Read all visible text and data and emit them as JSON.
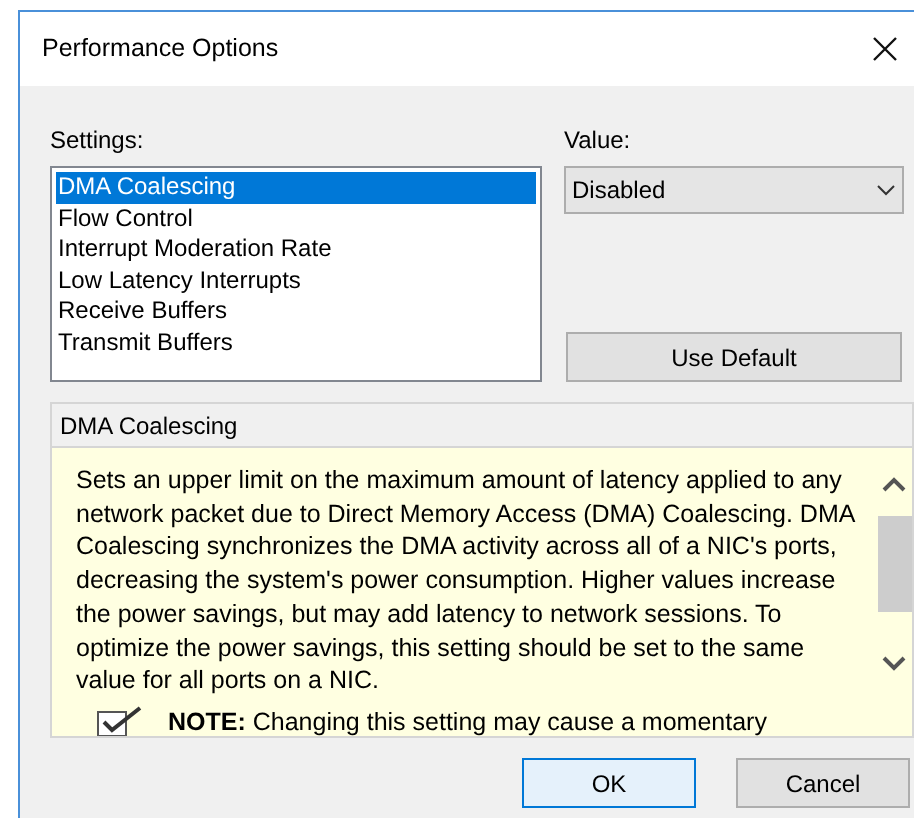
{
  "window": {
    "title": "Performance Options"
  },
  "settings": {
    "label": "Settings:",
    "items": [
      {
        "label": "DMA Coalescing",
        "selected": true
      },
      {
        "label": "Flow Control",
        "selected": false
      },
      {
        "label": "Interrupt Moderation Rate",
        "selected": false
      },
      {
        "label": "Low Latency Interrupts",
        "selected": false
      },
      {
        "label": "Receive Buffers",
        "selected": false
      },
      {
        "label": "Transmit Buffers",
        "selected": false
      }
    ]
  },
  "value": {
    "label": "Value:",
    "selected": "Disabled"
  },
  "use_default_button": "Use Default",
  "description": {
    "title": "DMA Coalescing",
    "text": "Sets an upper limit on the maximum amount of latency applied to any network packet due to Direct Memory Access (DMA) Coalescing. DMA Coalescing synchronizes the DMA activity across all of a NIC's ports, decreasing the system's power consumption. Higher values increase the power savings, but may add latency to network sessions. To optimize the power savings, this setting should be set to the same value for all ports on a NIC.",
    "note": "**NOTE:** Changing this setting may cause a momentary"
  },
  "buttons": [
    {
      "label": "OK",
      "default": true
    },
    {
      "label": "Cancel",
      "default": false
    }
  ]
}
